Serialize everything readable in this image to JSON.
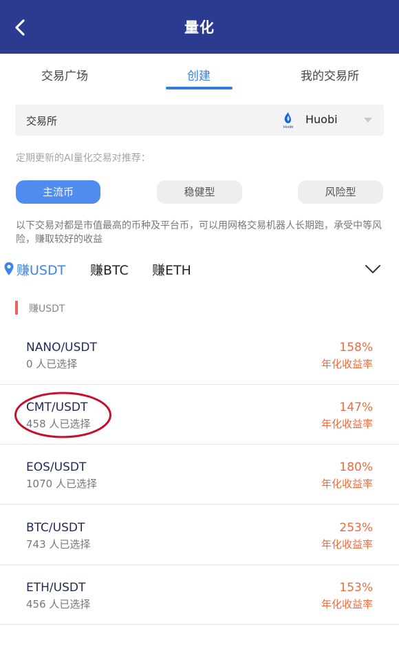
{
  "header": {
    "title": "量化"
  },
  "tabs": [
    {
      "label": "交易广场"
    },
    {
      "label": "创建"
    },
    {
      "label": "我的交易所"
    }
  ],
  "exchange": {
    "label": "交易所",
    "logo_text": "Huobi",
    "value": "Huobi"
  },
  "hint": "定期更新的AI量化交易对推荐：",
  "filters": [
    {
      "label": "主流币"
    },
    {
      "label": "稳健型"
    },
    {
      "label": "风险型"
    }
  ],
  "description": "以下交易对都是市值最高的币种及平台币，可以用网格交易机器人长期跑，承受中等风险，赚取较好的收益",
  "coin_tabs": [
    {
      "label": "赚USDT"
    },
    {
      "label": "赚BTC"
    },
    {
      "label": "赚ETH"
    }
  ],
  "section": {
    "title": "赚USDT"
  },
  "pairs": [
    {
      "pair": "NANO/USDT",
      "selected": "0 人已选择",
      "rate": "158%",
      "rate_label": "年化收益率"
    },
    {
      "pair": "CMT/USDT",
      "selected": "458 人已选择",
      "rate": "147%",
      "rate_label": "年化收益率"
    },
    {
      "pair": "EOS/USDT",
      "selected": "1070 人已选择",
      "rate": "180%",
      "rate_label": "年化收益率"
    },
    {
      "pair": "BTC/USDT",
      "selected": "743 人已选择",
      "rate": "253%",
      "rate_label": "年化收益率"
    },
    {
      "pair": "ETH/USDT",
      "selected": "456 人已选择",
      "rate": "153%",
      "rate_label": "年化收益率"
    }
  ],
  "colors": {
    "header": "#2b3b8f",
    "accent": "#2f7fe6",
    "rate": "#f06a3a",
    "annotation": "#c8102e"
  }
}
